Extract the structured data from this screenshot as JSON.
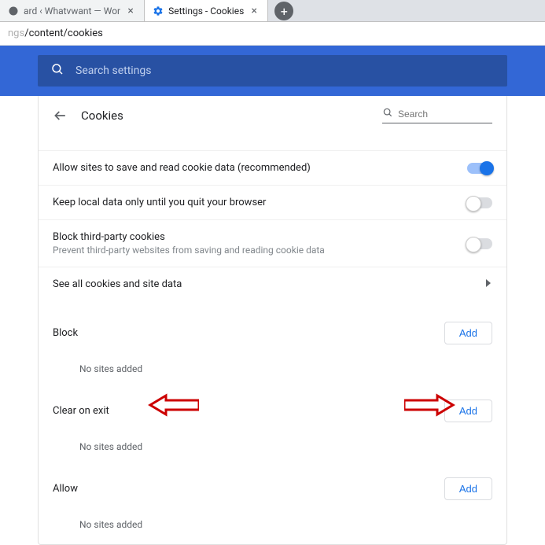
{
  "tabs": [
    {
      "label": "ard ‹ Whatvwant — Wor",
      "favicon": "wp",
      "active": false
    },
    {
      "label": "Settings - Cookies",
      "favicon": "gear",
      "active": true
    }
  ],
  "url": {
    "gray": "ngs",
    "dark": "/content/cookies"
  },
  "header": {
    "search_placeholder": "Search settings"
  },
  "page": {
    "title": "Cookies",
    "search_placeholder": "Search",
    "rows": {
      "allow_save": {
        "label": "Allow sites to save and read cookie data (recommended)",
        "on": true
      },
      "keep_until_quit": {
        "label": "Keep local data only until you quit your browser",
        "on": false
      },
      "block_third": {
        "label": "Block third-party cookies",
        "sub": "Prevent third-party websites from saving and reading cookie data",
        "on": false
      },
      "see_all": {
        "label": "See all cookies and site data"
      }
    },
    "sections": {
      "block": {
        "title": "Block",
        "add": "Add",
        "empty": "No sites added"
      },
      "clear": {
        "title": "Clear on exit",
        "add": "Add",
        "empty": "No sites added"
      },
      "allow": {
        "title": "Allow",
        "add": "Add",
        "empty": "No sites added"
      }
    }
  }
}
